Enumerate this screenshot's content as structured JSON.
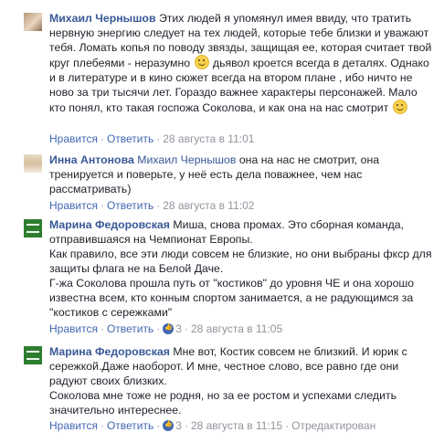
{
  "comments": [
    {
      "author": "Михаил Чернышов",
      "avatar": "fox-icon",
      "segments": [
        "Этих людей я упомянул имея ввиду, что тратить нервную энергию следует на тех людей, которые тебе близки и уважают тебя. Ломать копья по поводу звязды, защищая ее, которая считает твой круг плебеями - неразумно ",
        "дьявол кроется всегда в деталях. Однако и в литературе и в кино сюжет всегда на втором плане , ибо ничто не ново за три тысячи лет. Гораздо важнее характеры персонажей. Мало кто понял, кто такая госпожа Соколова, и как она на нас смотрит "
      ],
      "like": "Нравится",
      "reply": "Ответить",
      "time": "28 августа в 11:01"
    },
    {
      "author": "Инна Антонова",
      "mention": "Михаил Чернышов",
      "text": " она на нас не смотрит, она тренируется и поверьте, у неё есть дела поважнее, чем нас рассматривать)",
      "like": "Нравится",
      "reply": "Ответить",
      "time": "28 августа в 11:02"
    },
    {
      "author": "Марина Федоровская",
      "lines": [
        "Миша, снова промах. Это сборная команда, отправившаяся на Чемпионат Европы.",
        "Как правило, все эти люди совсем не близкие, но они выбраны фкср для защиты флага не на Белой Даче.",
        "Г-жа Соколова прошла путь от \"костиков\" до уровня ЧЕ и она хорошо известна всем, кто конным спортом занимается, а не радующимся за \"костиков с сережками\""
      ],
      "like": "Нравится",
      "reply": "Ответить",
      "likes_count": "3",
      "time": "28 августа в 11:05"
    },
    {
      "author": "Марина Федоровская",
      "lines": [
        "Мне вот, Костик совсем не близкий. И юрик с сережкой.Даже наоборот. И мне, честное слово, все равно где они радуют своих близких.",
        "Соколова мне тоже не родня, но за ее ростом и успехами следить значительно интереснее."
      ],
      "like": "Нравится",
      "reply": "Ответить",
      "likes_count": "3",
      "time": "28 августа в 11:15",
      "edited": "Отредактирован"
    }
  ]
}
